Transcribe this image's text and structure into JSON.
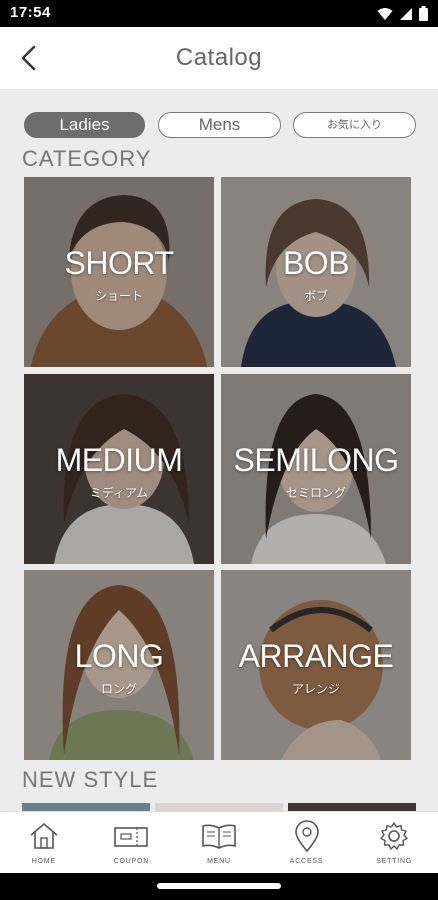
{
  "status_bar": {
    "time": "17:54",
    "icons": [
      "wifi-icon",
      "signal-icon",
      "battery-icon"
    ]
  },
  "header": {
    "title": "Catalog",
    "back_icon": "chevron-left-icon"
  },
  "tabs": [
    {
      "label": "Ladies",
      "active": true
    },
    {
      "label": "Mens",
      "active": false
    },
    {
      "label": "お気に入り",
      "active": false
    }
  ],
  "category": {
    "title": "CATEGORY",
    "items": [
      {
        "en": "SHORT",
        "ja": "ショート"
      },
      {
        "en": "BOB",
        "ja": "ボブ"
      },
      {
        "en": "MEDIUM",
        "ja": "ミディアム"
      },
      {
        "en": "SEMILONG",
        "ja": "セミロング"
      },
      {
        "en": "LONG",
        "ja": "ロング"
      },
      {
        "en": "ARRANGE",
        "ja": "アレンジ"
      }
    ]
  },
  "new_style": {
    "title": "NEW STYLE"
  },
  "bottom_nav": [
    {
      "label": "HOME",
      "icon": "home-icon"
    },
    {
      "label": "COUPON",
      "icon": "coupon-icon"
    },
    {
      "label": "MENU",
      "icon": "menu-book-icon"
    },
    {
      "label": "ACCESS",
      "icon": "map-pin-icon"
    },
    {
      "label": "SETTING",
      "icon": "gear-icon"
    }
  ],
  "colors": {
    "accent": "#6d6d6d",
    "background": "#ececec"
  }
}
